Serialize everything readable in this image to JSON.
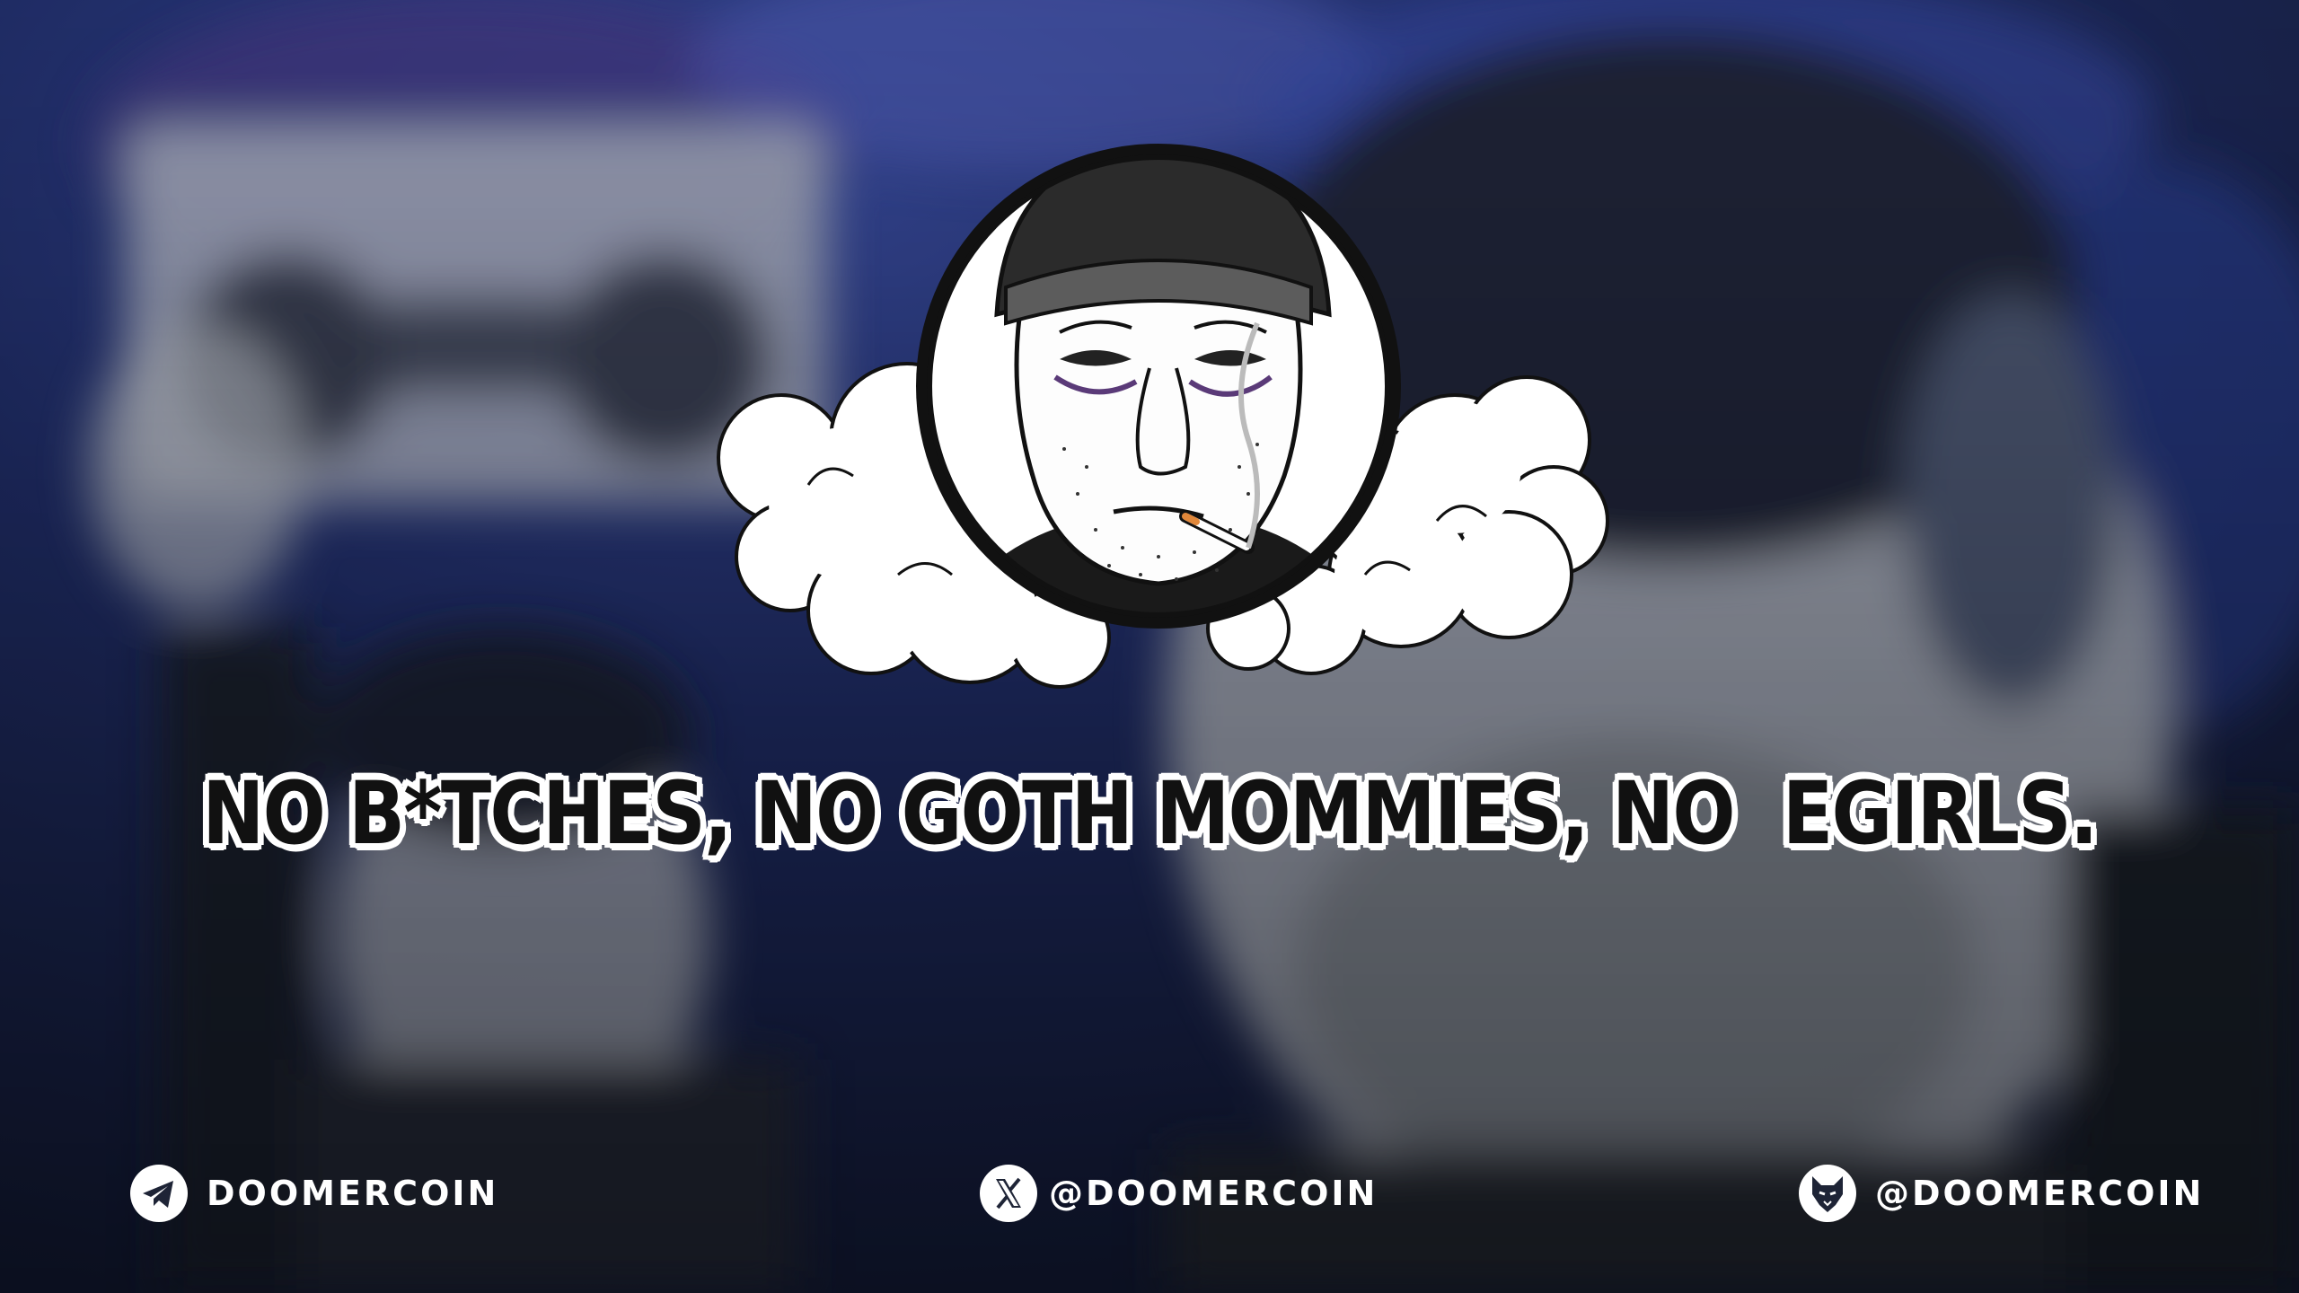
{
  "banner": {
    "headline": "NO B*TCHES, NO GOTH MOMMIES, NO  EGIRLS."
  },
  "socials": [
    {
      "icon": "telegram-icon",
      "label": "DOOMERCOIN"
    },
    {
      "icon": "x-icon",
      "label": "@DOOMERCOIN"
    },
    {
      "icon": "wolf-icon",
      "label": "@DOOMERCOIN"
    }
  ],
  "colors": {
    "background_dark": "#1a2236",
    "background_blue": "#2a3f86",
    "text_fill": "#111111",
    "text_outline": "#ffffff",
    "social_text": "#ffffff"
  }
}
